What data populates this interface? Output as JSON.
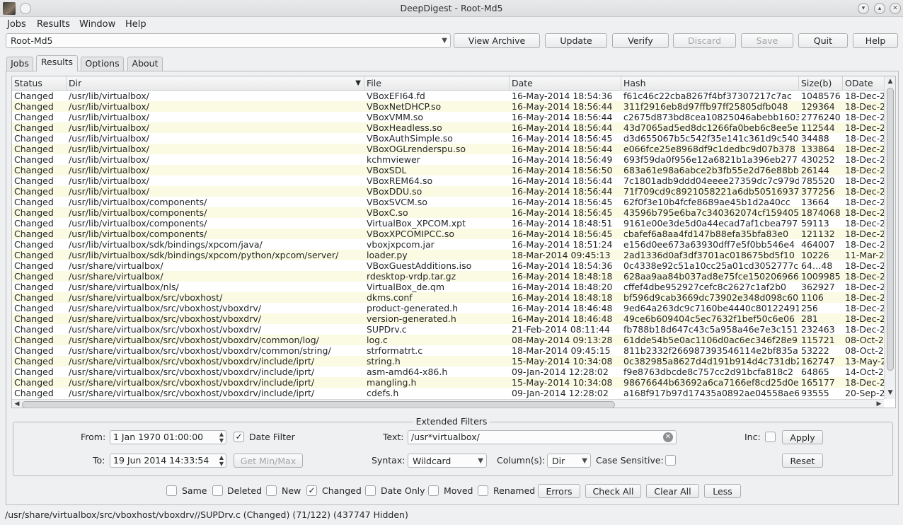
{
  "window": {
    "title": "DeepDigest - Root-Md5"
  },
  "menubar": [
    "Jobs",
    "Results",
    "Window",
    "Help"
  ],
  "toolbar": {
    "job_selected": "Root-Md5",
    "view_archive": "View Archive",
    "update": "Update",
    "verify": "Verify",
    "discard": "Discard",
    "save": "Save",
    "quit": "Quit",
    "help": "Help"
  },
  "tabs": [
    "Jobs",
    "Results",
    "Options",
    "About"
  ],
  "table": {
    "columns": [
      "Status",
      "Dir",
      "File",
      "Date",
      "Hash",
      "Size(b)",
      "ODate"
    ],
    "rows": [
      [
        "Changed",
        "/usr/lib/virtualbox/",
        "VBoxEFI64.fd",
        "16-May-2014 18:54:36",
        "f61c46c22cba8267f4bf37307217c7ac",
        "1048576",
        "18-Dec-2"
      ],
      [
        "Changed",
        "/usr/lib/virtualbox/",
        "VBoxNetDHCP.so",
        "16-May-2014 18:56:44",
        "311f2916eb8d97ffb97ff25805dfb048",
        "129364",
        "18-Dec-2"
      ],
      [
        "Changed",
        "/usr/lib/virtualbox/",
        "VBoxVMM.so",
        "16-May-2014 18:56:44",
        "c2675d873bd8cea10825046abebb1603",
        "2776240",
        "18-Dec-2"
      ],
      [
        "Changed",
        "/usr/lib/virtualbox/",
        "VBoxHeadless.so",
        "16-May-2014 18:56:44",
        "43d7065ad5ed8dc1266fa0beb6c8ee5e",
        "112544",
        "18-Dec-2"
      ],
      [
        "Changed",
        "/usr/lib/virtualbox/",
        "VBoxAuthSimple.so",
        "16-May-2014 18:56:45",
        "d3d655067b5c542f35e141c361d9c540",
        "34488",
        "18-Dec-2"
      ],
      [
        "Changed",
        "/usr/lib/virtualbox/",
        "VBoxOGLrenderspu.so",
        "16-May-2014 18:56:44",
        "e066fce25e8968df9c1dedbc9d07b378",
        "133864",
        "18-Dec-2"
      ],
      [
        "Changed",
        "/usr/lib/virtualbox/",
        "kchmviewer",
        "16-May-2014 18:56:49",
        "693f59da0f956e12a6821b1a396eb277",
        "430252",
        "18-Dec-2"
      ],
      [
        "Changed",
        "/usr/lib/virtualbox/",
        "VBoxSDL",
        "16-May-2014 18:56:50",
        "683a61e98a6abce2b3fb55e2d76e88bb",
        "26144",
        "18-Dec-2"
      ],
      [
        "Changed",
        "/usr/lib/virtualbox/",
        "VBoxREM64.so",
        "16-May-2014 18:56:44",
        "7c1801adb9ddd04eeee27359dc7c979d",
        "785520",
        "18-Dec-2"
      ],
      [
        "Changed",
        "/usr/lib/virtualbox/",
        "VBoxDDU.so",
        "16-May-2014 18:56:44",
        "71f709cd9c8921058221a6db50516937",
        "377256",
        "18-Dec-2"
      ],
      [
        "Changed",
        "/usr/lib/virtualbox/components/",
        "VBoxSVCM.so",
        "16-May-2014 18:56:45",
        "62f0f3e10b4fcfe8689ae45b1d2a40cc",
        "13664",
        "18-Dec-2"
      ],
      [
        "Changed",
        "/usr/lib/virtualbox/components/",
        "VBoxC.so",
        "16-May-2014 18:56:45",
        "43596b795e6ba7c340362074cf159405",
        "1874068",
        "18-Dec-2"
      ],
      [
        "Changed",
        "/usr/lib/virtualbox/components/",
        "VirtualBox_XPCOM.xpt",
        "16-May-2014 18:48:51",
        "9161e00e3de5d0a44ecad7af1cbea797",
        "59113",
        "18-Dec-2"
      ],
      [
        "Changed",
        "/usr/lib/virtualbox/components/",
        "VBoxXPCOMIPCC.so",
        "16-May-2014 18:56:45",
        "cbafef6a8aa4fd147b88efa35bfa83e0",
        "121132",
        "18-Dec-2"
      ],
      [
        "Changed",
        "/usr/lib/virtualbox/sdk/bindings/xpcom/java/",
        "vboxjxpcom.jar",
        "16-May-2014 18:51:24",
        "e156d0ee673a63930dff7e5f0bb546e4",
        "464007",
        "18-Dec-2"
      ],
      [
        "Changed",
        "/usr/lib/virtualbox/sdk/bindings/xpcom/python/xpcom/server/",
        "loader.py",
        "18-Mar-2014 09:45:13",
        "2ad1336d0af3df3701ac018675bd5f10",
        "10226",
        "11-Mar-2"
      ],
      [
        "Changed",
        "/usr/share/virtualbox/",
        "VBoxGuestAdditions.iso",
        "16-May-2014 18:54:36",
        "0c4338e92c51a10cc25a01cd3052777c",
        "64…48",
        "18-Dec-2"
      ],
      [
        "Changed",
        "/usr/share/virtualbox/",
        "rdesktop-vrdp.tar.gz",
        "16-May-2014 18:48:18",
        "628aa9aa84b037ad8e75fce150206966",
        "1009985",
        "18-Dec-2"
      ],
      [
        "Changed",
        "/usr/share/virtualbox/nls/",
        "VirtualBox_de.qm",
        "16-May-2014 18:48:20",
        "cffef4dbe952927cefc8c2627c1af2b0",
        "362927",
        "18-Dec-2"
      ],
      [
        "Changed",
        "/usr/share/virtualbox/src/vboxhost/",
        "dkms.conf",
        "16-May-2014 18:48:18",
        "bf596d9cab3669dc73902e348d098c60",
        "1106",
        "18-Dec-2"
      ],
      [
        "Changed",
        "/usr/share/virtualbox/src/vboxhost/vboxdrv/",
        "product-generated.h",
        "16-May-2014 18:46:48",
        "9ed64a263dc9c7160be4440c80122491",
        "256",
        "18-Dec-2"
      ],
      [
        "Changed",
        "/usr/share/virtualbox/src/vboxhost/vboxdrv/",
        "version-generated.h",
        "16-May-2014 18:46:48",
        "49ce6b609404c5ec7632f1bef50c6e06",
        "281",
        "18-Dec-2"
      ],
      [
        "Changed",
        "/usr/share/virtualbox/src/vboxhost/vboxdrv/",
        "SUPDrv.c",
        "21-Feb-2014 08:11:44",
        "fb788b18d647c43c5a958a46e7e3c151",
        "232463",
        "18-Dec-2"
      ],
      [
        "Changed",
        "/usr/share/virtualbox/src/vboxhost/vboxdrv/common/log/",
        "log.c",
        "08-May-2014 09:13:28",
        "61dde54b5e0ac1106d0ac6ec346f28e9",
        "115721",
        "08-Oct-2"
      ],
      [
        "Changed",
        "/usr/share/virtualbox/src/vboxhost/vboxdrv/common/string/",
        "strformatrt.c",
        "18-Mar-2014 09:45:15",
        "811b2332f266987393546114e2bf835a",
        "53222",
        "08-Oct-2"
      ],
      [
        "Changed",
        "/usr/share/virtualbox/src/vboxhost/vboxdrv/include/iprt/",
        "string.h",
        "15-May-2014 10:34:08",
        "0c382985a8627d4d191b914d4c731db2",
        "162747",
        "13-May-2"
      ],
      [
        "Changed",
        "/usr/share/virtualbox/src/vboxhost/vboxdrv/include/iprt/",
        "asm-amd64-x86.h",
        "09-Jan-2014 12:28:02",
        "f9e8763dbcde8c757cc2d91bcfa818c2",
        "64865",
        "14-Oct-2"
      ],
      [
        "Changed",
        "/usr/share/virtualbox/src/vboxhost/vboxdrv/include/iprt/",
        "mangling.h",
        "15-May-2014 10:34:08",
        "98676644b63692a6ca7166ef8cd25d0e",
        "165177",
        "18-Dec-2"
      ],
      [
        "Changed",
        "/usr/share/virtualbox/src/vboxhost/vboxdrv/include/iprt/",
        "cdefs.h",
        "09-Jan-2014 12:28:02",
        "a168f917b97d17435a0892ae04558ae6",
        "93555",
        "20-Sep-2"
      ]
    ]
  },
  "filters": {
    "group_title": "Extended Filters",
    "from_label": "From:",
    "from_value": "1 Jan 1970 01:00:00",
    "to_label": "To:",
    "to_value": "19 Jun 2014 14:33:54",
    "date_filter_label": "Date Filter",
    "date_filter_checked": true,
    "get_minmax": "Get Min/Max",
    "text_label": "Text:",
    "text_value": "/usr*virtualbox/",
    "syntax_label": "Syntax:",
    "syntax_value": "Wildcard",
    "columns_label": "Column(s):",
    "columns_value": "Dir",
    "case_label": "Case Sensitive:",
    "inc_label": "Inc:",
    "apply": "Apply",
    "reset": "Reset"
  },
  "bottom": {
    "same": "Same",
    "deleted": "Deleted",
    "new": "New",
    "changed": "Changed",
    "date_only": "Date Only",
    "moved": "Moved",
    "renamed": "Renamed",
    "errors": "Errors",
    "check_all": "Check All",
    "clear_all": "Clear All",
    "less": "Less"
  },
  "status": "/usr/share/virtualbox/src/vboxhost/vboxdrv//SUPDrv.c (Changed) (71/122) (437747 Hidden)"
}
